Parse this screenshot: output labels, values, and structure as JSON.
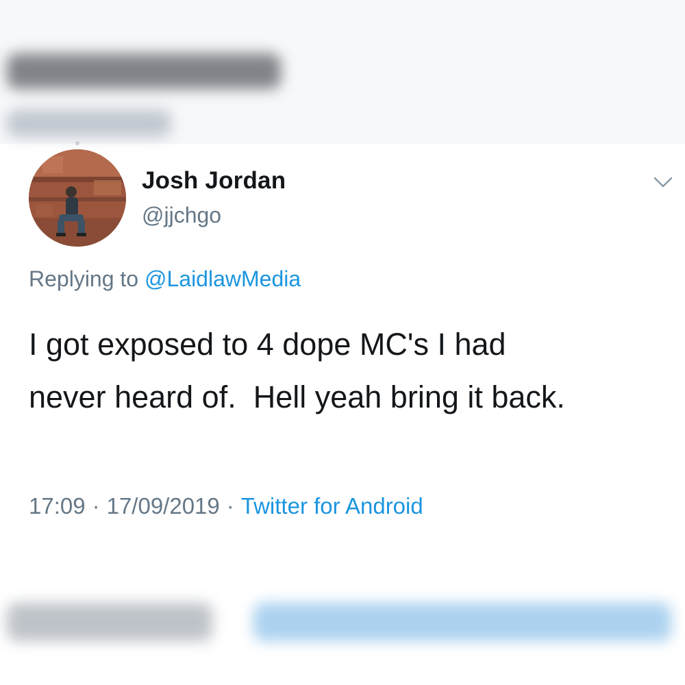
{
  "tweet": {
    "author": {
      "display_name": "Josh Jordan",
      "handle": "@jjchgo",
      "avatar_icon": "profile-photo"
    },
    "reply": {
      "prefix": "Replying to ",
      "to_handle": "@LaidlawMedia"
    },
    "text": "I got exposed to 4 dope MC's I had\nnever heard of.  Hell yeah bring it back.",
    "meta": {
      "time": "17:09",
      "separator": "·",
      "date": "17/09/2019",
      "source": "Twitter for Android"
    },
    "menu_icon": "chevron-down-icon"
  },
  "colors": {
    "text_primary": "#14171a",
    "text_secondary": "#657786",
    "link": "#1b95e0"
  }
}
